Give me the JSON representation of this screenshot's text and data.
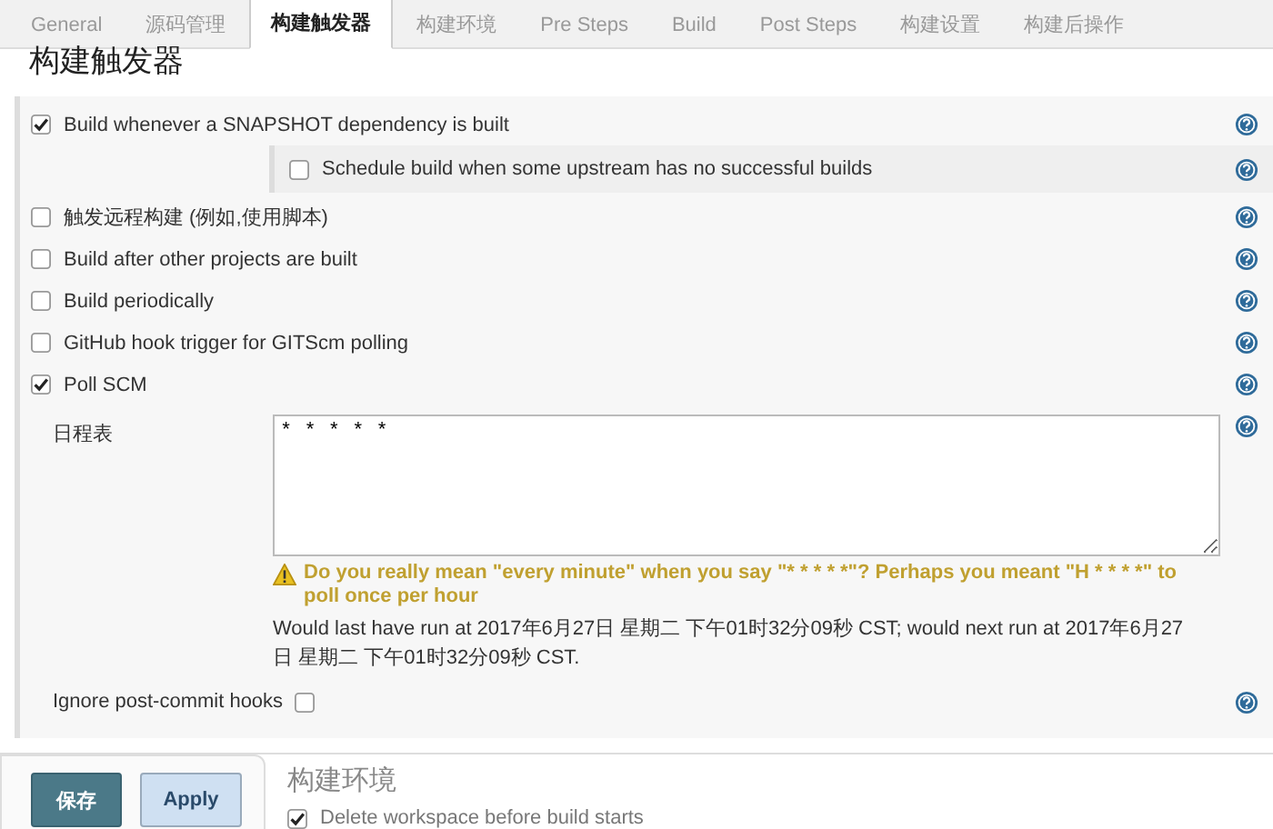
{
  "tabs": [
    {
      "label": "General",
      "selected": false
    },
    {
      "label": "源码管理",
      "selected": false
    },
    {
      "label": "构建触发器",
      "selected": true
    },
    {
      "label": "构建环境",
      "selected": false
    },
    {
      "label": "Pre Steps",
      "selected": false
    },
    {
      "label": "Build",
      "selected": false
    },
    {
      "label": "Post Steps",
      "selected": false
    },
    {
      "label": "构建设置",
      "selected": false
    },
    {
      "label": "构建后操作",
      "selected": false
    }
  ],
  "section": {
    "title": "构建触发器",
    "triggers": [
      {
        "label": "Build whenever a SNAPSHOT dependency is built",
        "checked": true,
        "children": [
          {
            "label": "Schedule build when some upstream has no successful builds",
            "checked": false
          }
        ]
      },
      {
        "label": "触发远程构建 (例如,使用脚本)",
        "checked": false
      },
      {
        "label": "Build after other projects are built",
        "checked": false
      },
      {
        "label": "Build periodically",
        "checked": false
      },
      {
        "label": "GitHub hook trigger for GITScm polling",
        "checked": false
      },
      {
        "label": "Poll SCM",
        "checked": true
      }
    ],
    "schedule": {
      "label": "日程表",
      "value": "* * * * *",
      "warning": "Do you really mean \"every minute\" when you say \"* * * * *\"? Perhaps you meant \"H * * * *\" to poll once per hour",
      "info": "Would last have run at 2017年6月27日 星期二 下午01时32分09秒 CST; would next run at 2017年6月27日 星期二 下午01时32分09秒 CST."
    },
    "ignore_hooks": {
      "label": "Ignore post-commit hooks",
      "checked": false
    }
  },
  "next_section": {
    "title": "构建环境",
    "items": [
      {
        "label": "Delete workspace before build starts",
        "checked": true
      }
    ]
  },
  "buttons": [
    {
      "label": "保存",
      "kind": "primary"
    },
    {
      "label": "Apply",
      "kind": "secondary"
    }
  ]
}
